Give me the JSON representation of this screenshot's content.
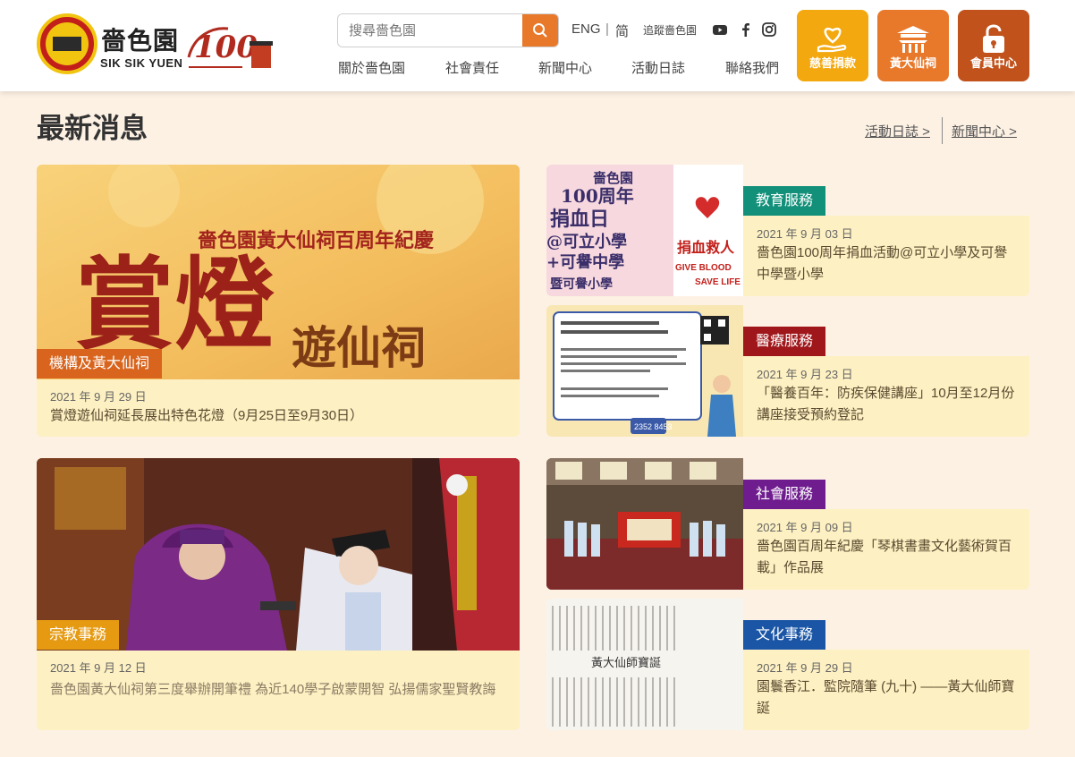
{
  "header": {
    "logo_zh": "嗇色園",
    "logo_en": "SIK SIK YUEN",
    "search_placeholder": "搜尋嗇色園",
    "lang_en": "ENG",
    "lang_sep": "|",
    "lang_zh": "简",
    "follow_label": "追蹤嗇色園",
    "nav": [
      "關於嗇色園",
      "社會責任",
      "新聞中心",
      "活動日誌",
      "聯絡我們"
    ],
    "tiles": [
      {
        "label": "慈善捐款",
        "color": "#f2a80e",
        "icon": "heart-hand-icon"
      },
      {
        "label": "黃大仙祠",
        "color": "#e8782a",
        "icon": "temple-icon"
      },
      {
        "label": "會員中心",
        "color": "#c1521b",
        "icon": "lock-icon"
      }
    ]
  },
  "section": {
    "title": "最新消息",
    "links": [
      "活動日誌 >",
      "新聞中心 >"
    ]
  },
  "featured": [
    {
      "tag": "機構及黃大仙祠",
      "date": "2021 年 9 月 29 日",
      "headline": "賞燈遊仙祠延長展出特色花燈（9月25日至9月30日）",
      "img_sub": "嗇色園黃大仙祠百周年紀慶",
      "img_main": "賞燈",
      "img_main2": "遊仙祠"
    },
    {
      "tag": "宗教事務",
      "date": "2021 年 9 月 12 日",
      "headline": "嗇色園黃大仙祠第三度舉辦開筆禮 為近140學子啟蒙開智 弘揚儒家聖賢教誨"
    }
  ],
  "news": [
    {
      "tag": "教育服務",
      "tag_color": "#12907a",
      "date": "2021 年 9 月 03 日",
      "headline": "嗇色園100周年捐血活動@可立小學及可譽中學暨小學",
      "img_l1": "嗇色園",
      "img_l2": "100周年",
      "img_l3": "捐血日",
      "img_l4": "@可立小學",
      "img_l5": "+可譽中學",
      "img_l6": "暨可譽小學",
      "img_r1": "捐血救人",
      "img_r2": "GIVE BLOOD",
      "img_r3": "SAVE LIFE"
    },
    {
      "tag": "醫療服務",
      "tag_color": "#a0171b",
      "date": "2021 年 9 月 23 日",
      "headline": "「醫養百年：防疾保健講座」10月至12月份講座接受預約登記",
      "img_phone": "2352 8453"
    },
    {
      "tag": "社會服務",
      "tag_color": "#6f1c8e",
      "date": "2021 年 9 月 09 日",
      "headline": "嗇色園百周年紀慶「琴棋書畫文化藝術賀百載」作品展"
    },
    {
      "tag": "文化事務",
      "tag_color": "#1b56a6",
      "date": "2021 年 9 月 29 日",
      "headline": "園鬟香江．監院隨筆 (九十) ——黃大仙師寶誕",
      "img_text": "黃大仙師寶誕"
    }
  ]
}
